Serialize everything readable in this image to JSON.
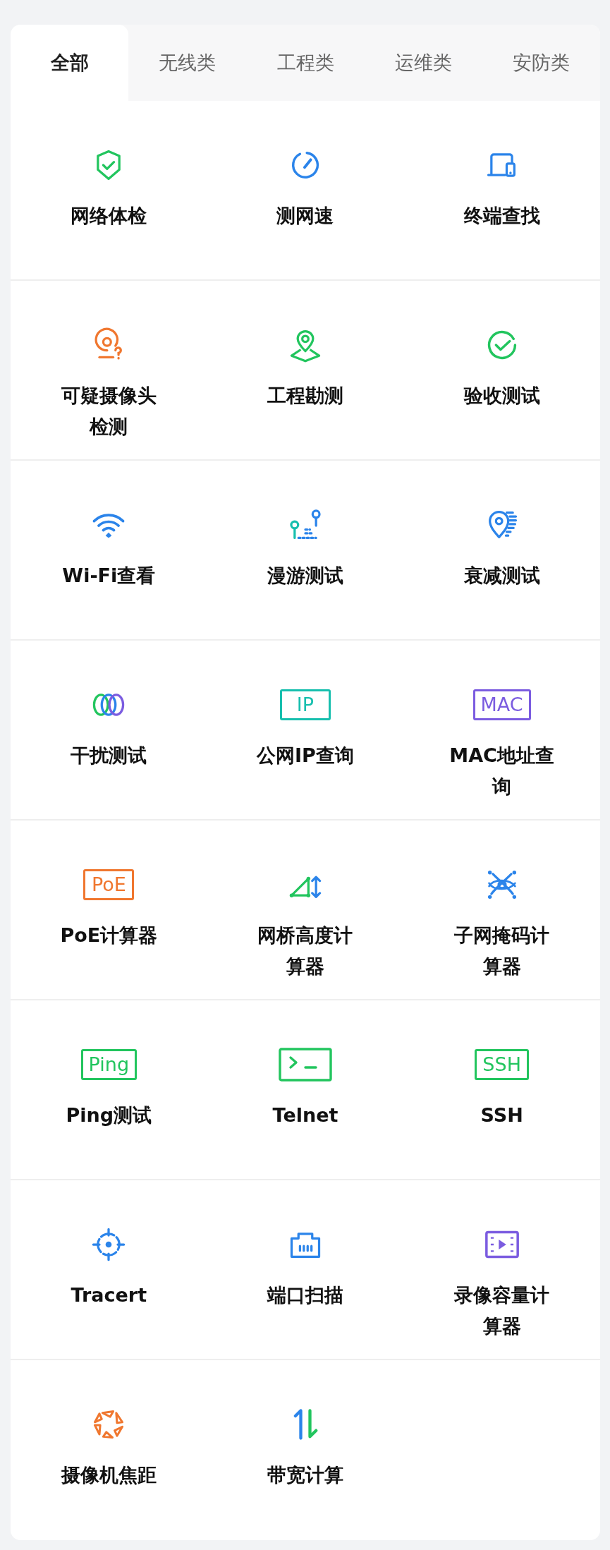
{
  "tabs": [
    {
      "label": "全部",
      "selected": true
    },
    {
      "label": "无线类",
      "selected": false
    },
    {
      "label": "工程类",
      "selected": false
    },
    {
      "label": "运维类",
      "selected": false
    },
    {
      "label": "安防类",
      "selected": false
    }
  ],
  "tool_rows": [
    {
      "tools": [
        {
          "label": "网络体检",
          "icon": {
            "kind": "shield"
          }
        },
        {
          "label": "测网速",
          "icon": {
            "kind": "gauge"
          }
        },
        {
          "label": "终端查找",
          "icon": {
            "kind": "devices"
          }
        }
      ]
    },
    {
      "tools": [
        {
          "label": "可疑摄像头检测",
          "icon": {
            "kind": "camera-question"
          }
        },
        {
          "label": "工程勘测",
          "icon": {
            "kind": "map-pin"
          }
        },
        {
          "label": "验收测试",
          "icon": {
            "kind": "check-circle"
          }
        }
      ]
    },
    {
      "tools": [
        {
          "label": "Wi-Fi查看",
          "icon": {
            "kind": "wifi"
          }
        },
        {
          "label": "漫游测试",
          "icon": {
            "kind": "roaming"
          }
        },
        {
          "label": "衰减测试",
          "icon": {
            "kind": "pin-fade"
          }
        }
      ]
    },
    {
      "tools": [
        {
          "label": "干扰测试",
          "icon": {
            "kind": "rings"
          }
        },
        {
          "label": "公网IP查询",
          "icon": {
            "kind": "text-badge",
            "text": "IP"
          }
        },
        {
          "label": "MAC地址查询",
          "icon": {
            "kind": "text-badge",
            "text": "MAC"
          }
        }
      ]
    },
    {
      "tools": [
        {
          "label": "PoE计算器",
          "icon": {
            "kind": "text-badge",
            "text": "PoE"
          }
        },
        {
          "label": "网桥高度计算器",
          "icon": {
            "kind": "triangle-height"
          }
        },
        {
          "label": "子网掩码计算器",
          "icon": {
            "kind": "orbit"
          }
        }
      ]
    },
    {
      "tools": [
        {
          "label": "Ping测试",
          "icon": {
            "kind": "text-badge",
            "text": "Ping"
          }
        },
        {
          "label": "Telnet",
          "icon": {
            "kind": "terminal"
          }
        },
        {
          "label": "SSH",
          "icon": {
            "kind": "text-badge",
            "text": "SSH"
          }
        }
      ]
    },
    {
      "tools": [
        {
          "label": "Tracert",
          "icon": {
            "kind": "target"
          }
        },
        {
          "label": "端口扫描",
          "icon": {
            "kind": "port"
          }
        },
        {
          "label": "录像容量计算器",
          "icon": {
            "kind": "film"
          }
        }
      ]
    },
    {
      "tools": [
        {
          "label": "摄像机焦距",
          "icon": {
            "kind": "aperture"
          }
        },
        {
          "label": "带宽计算",
          "icon": {
            "kind": "updown"
          }
        }
      ]
    }
  ]
}
